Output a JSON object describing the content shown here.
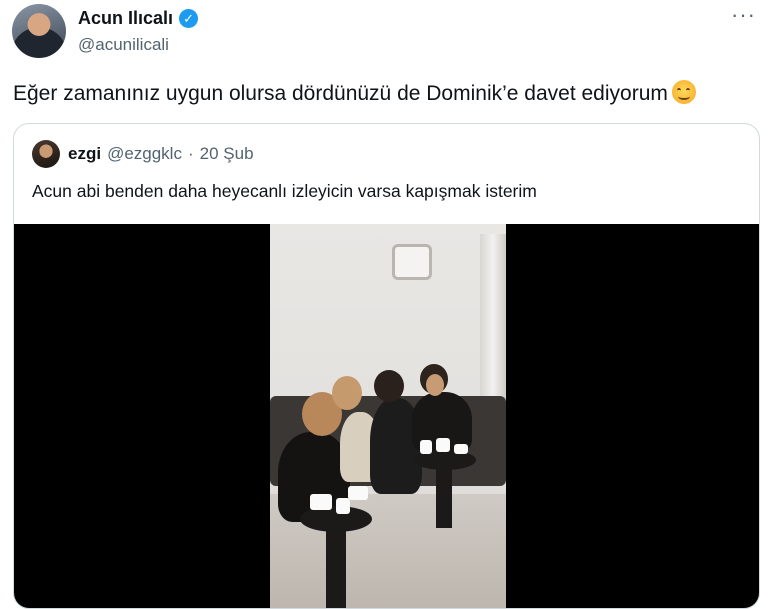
{
  "tweet": {
    "author_name": "Acun Ilıcalı",
    "author_handle": "@acunilicali",
    "text": "Eğer zamanınız uygun olursa dördünüzü de Dominik’e davet ediyorum",
    "more_label": "···",
    "verified_mark": "✓"
  },
  "quoted": {
    "author_name": "ezgi",
    "author_handle": "@ezggklc",
    "separator": "·",
    "date": "20 Şub",
    "text": "Acun abi benden daha heyecanlı izleyicin varsa kapışmak isterim"
  },
  "icons": {
    "verified": "verified-badge-icon",
    "more": "more-options-icon",
    "emoji": "smiling-face-emoji"
  },
  "colors": {
    "accent": "#1d9bf0",
    "text_primary": "#0f1419",
    "text_secondary": "#536471",
    "border": "#cfd9de"
  }
}
